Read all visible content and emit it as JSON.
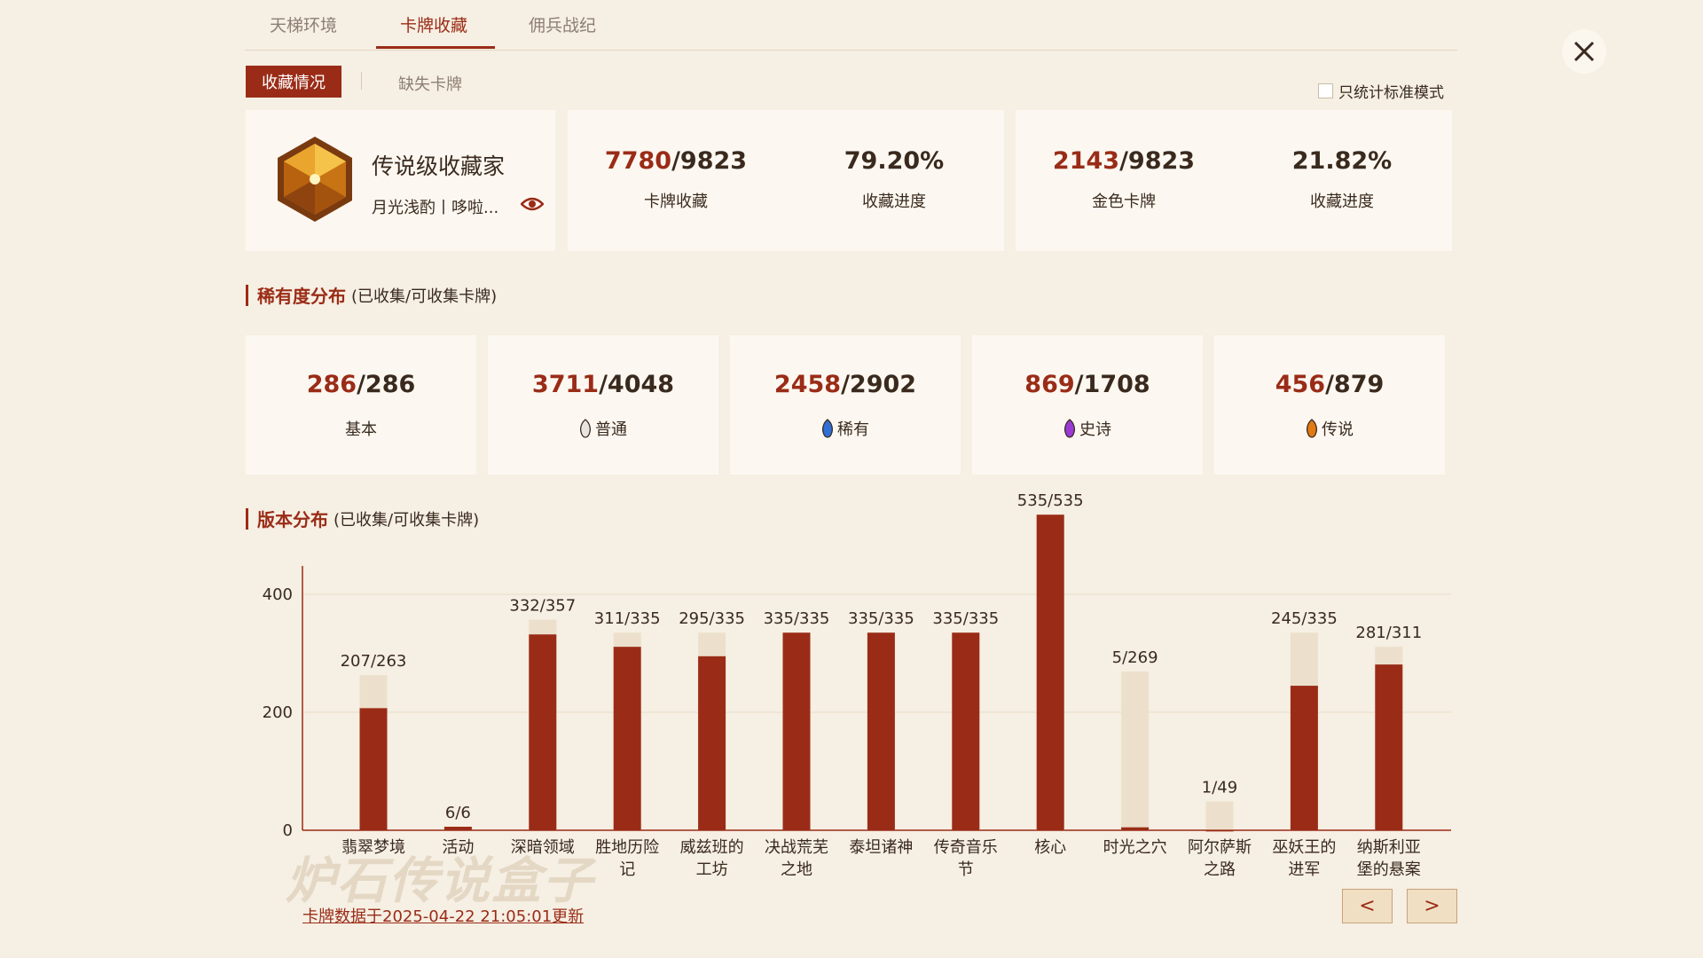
{
  "tabs": [
    "天梯环境",
    "卡牌收藏",
    "佣兵战纪"
  ],
  "subtabs": {
    "active": "收藏情况",
    "other": "缺失卡牌"
  },
  "standard_only_label": "只统计标准模式",
  "collector": {
    "title": "传说级收藏家",
    "subtitle": "月光浅酌丨哆啦..."
  },
  "stats": {
    "cards": {
      "collected": "7780",
      "total": "/9823",
      "label": "卡牌收藏"
    },
    "cards_progress": {
      "value": "79.20%",
      "label": "收藏进度"
    },
    "golden": {
      "collected": "2143",
      "total": "/9823",
      "label": "金色卡牌"
    },
    "golden_progress": {
      "value": "21.82%",
      "label": "收藏进度"
    }
  },
  "rarity_section": {
    "title": "稀有度分布",
    "note": "(已收集/可收集卡牌)"
  },
  "rarity": [
    {
      "collected": "286",
      "total": "/286",
      "label": "基本",
      "gem": ""
    },
    {
      "collected": "3711",
      "total": "/4048",
      "label": "普通",
      "gem": "#e8e4de"
    },
    {
      "collected": "2458",
      "total": "/2902",
      "label": "稀有",
      "gem": "#2f6fd6"
    },
    {
      "collected": "869",
      "total": "/1708",
      "label": "史诗",
      "gem": "#9b3ad6"
    },
    {
      "collected": "456",
      "total": "/879",
      "label": "传说",
      "gem": "#e07a12"
    }
  ],
  "version_section": {
    "title": "版本分布",
    "note": "(已收集/可收集卡牌)"
  },
  "chart_data": {
    "type": "bar",
    "categories": [
      [
        "翡翠梦境"
      ],
      [
        "活动"
      ],
      [
        "深暗领域"
      ],
      [
        "胜地历险",
        "记"
      ],
      [
        "威兹班的",
        "工坊"
      ],
      [
        "决战荒芜",
        "之地"
      ],
      [
        "泰坦诸神"
      ],
      [
        "传奇音乐",
        "节"
      ],
      [
        "核心"
      ],
      [
        "时光之穴"
      ],
      [
        "阿尔萨斯",
        "之路"
      ],
      [
        "巫妖王的",
        "进军"
      ],
      [
        "纳斯利亚",
        "堡的悬案"
      ]
    ],
    "series": [
      {
        "values": [
          207,
          6,
          332,
          311,
          295,
          335,
          335,
          335,
          535,
          5,
          1,
          245,
          281
        ]
      },
      {
        "values": [
          263,
          6,
          357,
          335,
          335,
          335,
          335,
          335,
          535,
          269,
          49,
          335,
          311
        ]
      }
    ],
    "data_labels": [
      "207/263",
      "6/6",
      "332/357",
      "311/335",
      "295/335",
      "335/335",
      "335/335",
      "335/335",
      "535/535",
      "5/269",
      "1/49",
      "245/335",
      "281/311"
    ],
    "yticks": [
      0,
      200,
      400
    ],
    "ylim": [
      0,
      450
    ],
    "grid": true,
    "colors": {
      "collected": "#9a2c17",
      "total": "#ece0cc"
    }
  },
  "update_note": "卡牌数据于2025-04-22 21:05:01更新",
  "watermark": "炉石传说盒子",
  "pager": {
    "prev": "<",
    "next": ">"
  }
}
